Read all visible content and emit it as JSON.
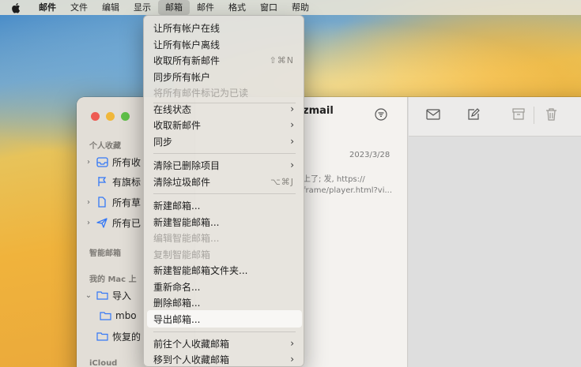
{
  "menubar": {
    "app": "邮件",
    "items": [
      "文件",
      "编辑",
      "显示",
      "邮箱",
      "邮件",
      "格式",
      "窗口",
      "帮助"
    ],
    "active": "邮箱"
  },
  "menu": {
    "items": [
      {
        "label": "让所有帐户在线",
        "enabled": true
      },
      {
        "label": "让所有帐户离线",
        "enabled": true
      },
      {
        "label": "收取所有新邮件",
        "enabled": true,
        "shortcut": "⇧⌘N"
      },
      {
        "label": "同步所有帐户",
        "enabled": true
      },
      {
        "label": "将所有邮件标记为已读",
        "enabled": false
      },
      {
        "label": "在线状态",
        "enabled": true,
        "submenu": true
      },
      {
        "label": "收取新邮件",
        "enabled": true,
        "submenu": true
      },
      {
        "label": "同步",
        "enabled": true,
        "submenu": true
      },
      {
        "label": "清除已删除项目",
        "enabled": true,
        "submenu": true
      },
      {
        "label": "清除垃圾邮件",
        "enabled": true,
        "shortcut": "⌥⌘J"
      },
      {
        "label": "新建邮箱...",
        "enabled": true
      },
      {
        "label": "新建智能邮箱...",
        "enabled": true
      },
      {
        "label": "编辑智能邮箱...",
        "enabled": false
      },
      {
        "label": "复制智能邮箱",
        "enabled": false
      },
      {
        "label": "新建智能邮箱文件夹...",
        "enabled": true
      },
      {
        "label": "重新命名...",
        "enabled": true
      },
      {
        "label": "删除邮箱...",
        "enabled": true
      },
      {
        "label": "导出邮箱...",
        "enabled": true,
        "highlighted": true
      },
      {
        "label": "前往个人收藏邮箱",
        "enabled": true,
        "submenu": true
      },
      {
        "label": "移到个人收藏邮箱",
        "enabled": true,
        "submenu": true
      }
    ]
  },
  "sidebar": {
    "favorites_header": "个人收藏",
    "smart_header": "智能邮箱",
    "mac_header": "我的 Mac 上",
    "icloud_header": "iCloud",
    "favorites": [
      {
        "label": "所有收",
        "icon": "inbox-icon",
        "chevron": true
      },
      {
        "label": "有旗标",
        "icon": "flag-icon",
        "chevron": false
      },
      {
        "label": "所有草",
        "icon": "document-icon",
        "chevron": true
      },
      {
        "label": "所有已",
        "icon": "sent-icon",
        "chevron": true
      }
    ],
    "mac_items": [
      {
        "label": "导入",
        "icon": "folder-icon",
        "chevron": true
      },
      {
        "label": "mbo",
        "icon": "folder-icon",
        "chevron": false
      },
      {
        "label": "恢复的",
        "icon": "folder-icon",
        "chevron": false
      }
    ]
  },
  "message_list": {
    "title_fragment": "zmail",
    "date": "2023/3/28",
    "snippet": "上了; 发, https://\nframe/player.html?vi..."
  },
  "colors": {
    "accent_red": "#ee5b53",
    "accent_yellow": "#f0b73a",
    "accent_green": "#5fc048",
    "sidebar_icon_blue": "#3478f6"
  }
}
